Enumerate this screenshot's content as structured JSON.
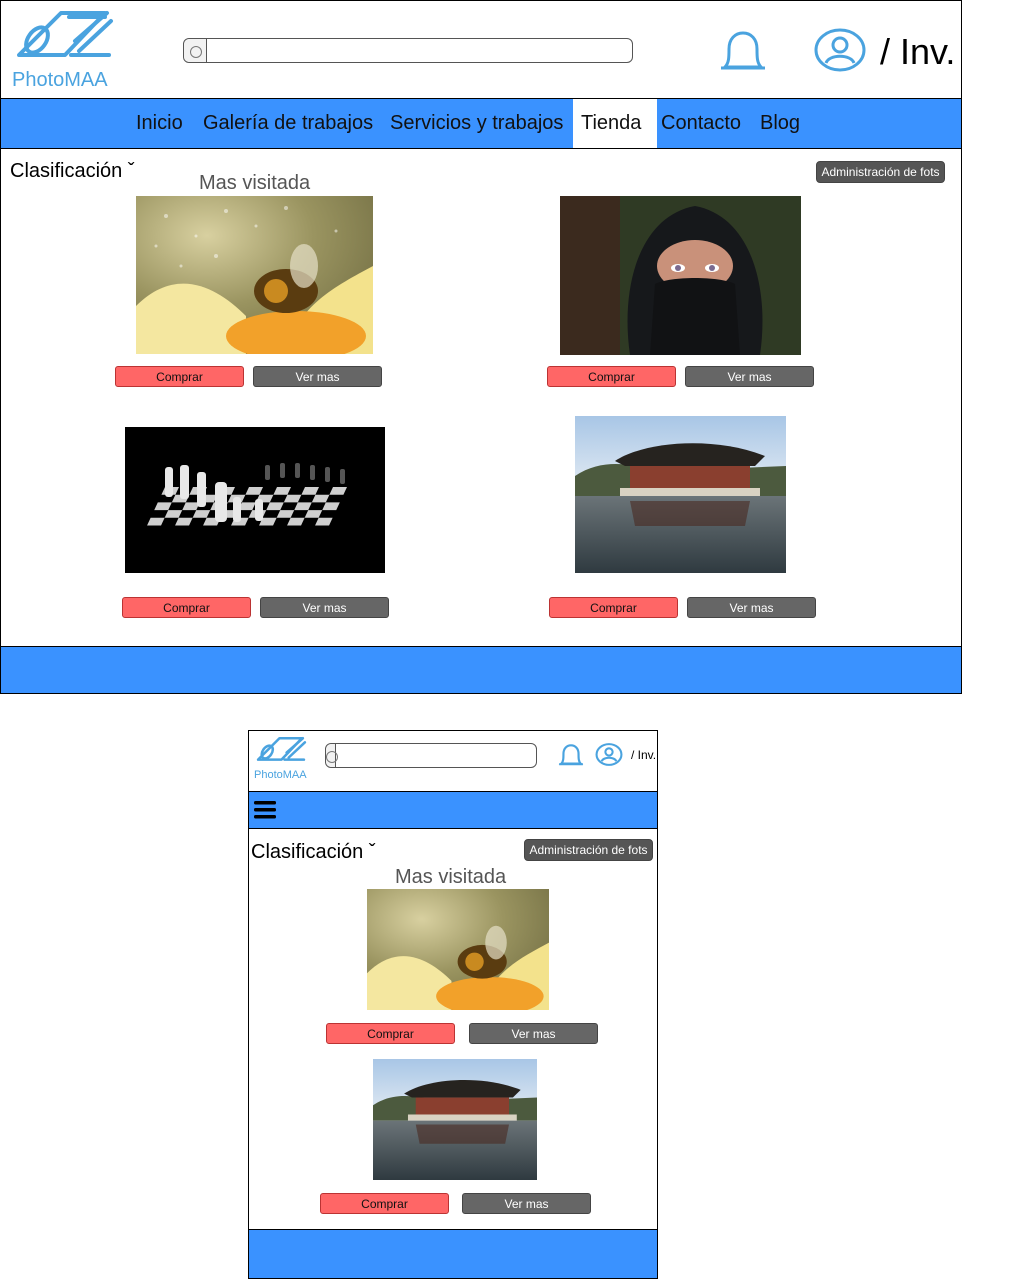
{
  "brand": {
    "name": "PhotoMAA"
  },
  "search": {
    "value": ""
  },
  "user": {
    "label": "/ Inv."
  },
  "nav": {
    "items": [
      {
        "label": "Inicio"
      },
      {
        "label": "Galería de trabajos"
      },
      {
        "label": "Servicios y trabajos"
      },
      {
        "label": "Tienda",
        "active": true
      },
      {
        "label": "Contacto"
      },
      {
        "label": "Blog"
      }
    ]
  },
  "content": {
    "sort_label": "Clasificación ˇ",
    "admin_label": "Administración de fots",
    "section_title": "Mas visitada",
    "buy_label": "Comprar",
    "more_label": "Ver mas"
  },
  "photos": [
    {
      "subject": "bee on yellow flower"
    },
    {
      "subject": "woman in black niqab"
    },
    {
      "subject": "chess pieces on board"
    },
    {
      "subject": "pavilion by the lake"
    }
  ],
  "colors": {
    "brand_blue": "#3a92ff",
    "icon_blue": "#4aa3df",
    "buy_red": "#ff6666",
    "more_gray": "#666666"
  }
}
